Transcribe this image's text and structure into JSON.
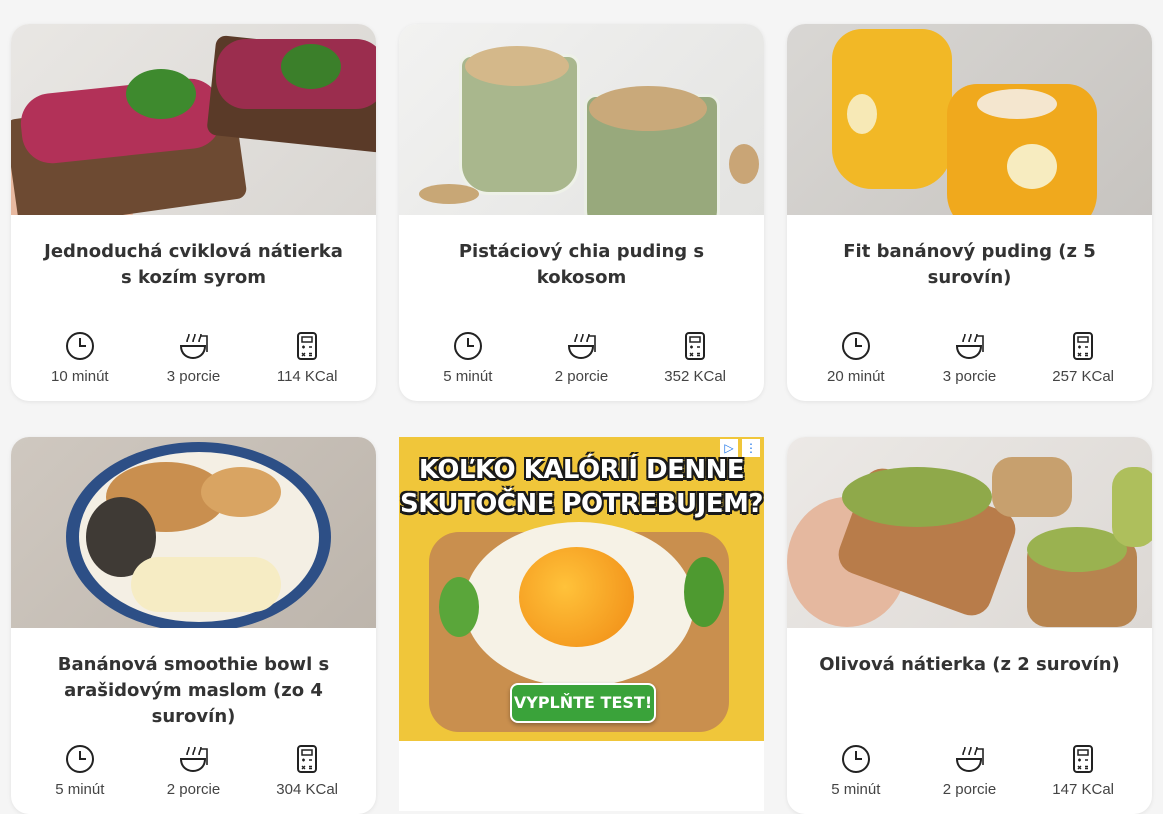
{
  "recipes": [
    {
      "title": "Jednoduchá cviklová nátierka s kozím syrom",
      "time": "10 minút",
      "portions": "3 porcie",
      "kcal": "114 KCal"
    },
    {
      "title": "Pistáciový chia puding s kokosom",
      "time": "5 minút",
      "portions": "2 porcie",
      "kcal": "352 KCal"
    },
    {
      "title": "Fit banánový puding (z 5 surovín)",
      "time": "20 minút",
      "portions": "3 porcie",
      "kcal": "257 KCal"
    },
    {
      "title": "Banánová smoothie bowl s arašidovým maslom (zo 4 surovín)",
      "time": "5 minút",
      "portions": "2 porcie",
      "kcal": "304 KCal"
    },
    {
      "title": "Olivová nátierka (z 2 surovín)",
      "time": "5 minút",
      "portions": "2 porcie",
      "kcal": "147 KCal"
    }
  ],
  "ad": {
    "headline_line1": "KOĽKO KALÓRIÍ DENNE",
    "headline_line2": "SKUTOČNE POTREBUJEM?",
    "cta": "VYPLŇTE TEST!"
  },
  "icons": {
    "time": "clock-icon",
    "portions": "bowl-icon",
    "kcal": "calculator-icon"
  }
}
